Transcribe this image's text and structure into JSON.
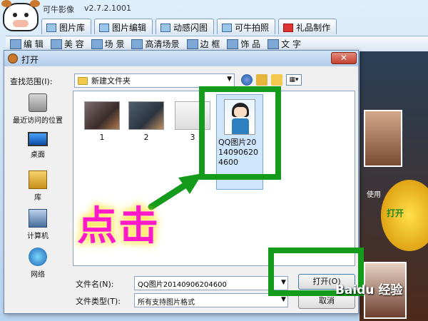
{
  "app": {
    "title": "可牛影像",
    "version": "v2.7.2.1001",
    "tabs": [
      {
        "label": "图片库"
      },
      {
        "label": "图片编辑"
      },
      {
        "label": "动感闪图"
      },
      {
        "label": "可牛拍照"
      },
      {
        "label": "礼品制作"
      }
    ],
    "tools": [
      {
        "label": "编 辑"
      },
      {
        "label": "美 容"
      },
      {
        "label": "场 景"
      },
      {
        "label": "高清场景"
      },
      {
        "label": "边 框"
      },
      {
        "label": "饰 品"
      },
      {
        "label": "文 字"
      }
    ],
    "right_panel": {
      "use_label": "使用",
      "open_label": "打开"
    },
    "watermark": "Baidu 经验"
  },
  "dialog": {
    "title": "打开",
    "close_label": "✕",
    "look_in_label": "查找范围(I):",
    "look_in_value": "新建文件夹",
    "places": [
      {
        "label": "最近访问的位置"
      },
      {
        "label": "桌面"
      },
      {
        "label": "库"
      },
      {
        "label": "计算机"
      },
      {
        "label": "网络"
      }
    ],
    "files": [
      {
        "label": "1"
      },
      {
        "label": "2"
      },
      {
        "label": "3"
      },
      {
        "label": "QQ图片20140906204600"
      }
    ],
    "file_name_label": "文件名(N):",
    "file_name_value": "QQ图片20140906204600",
    "file_type_label": "文件类型(T):",
    "file_type_value": "所有支持图片格式",
    "open_button": "打开(O)",
    "cancel_button": "取消"
  },
  "annotation": {
    "click_label": "点击",
    "color": "#149b1c",
    "label_color": "#ff19c8"
  }
}
